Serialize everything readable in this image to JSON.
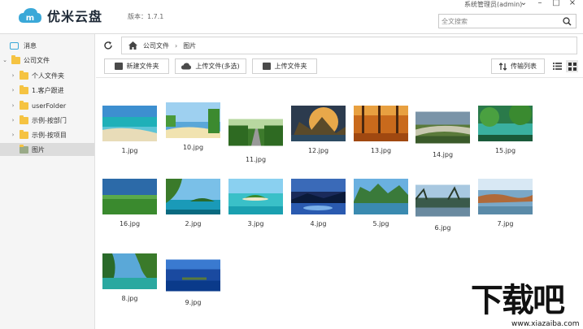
{
  "header": {
    "app_name": "优米云盘",
    "version": "版本：1.7.1",
    "user": "系统管理员(admin)",
    "search_placeholder": "全文搜索"
  },
  "sidebar": {
    "items": [
      {
        "label": "消息",
        "icon": "message-icon",
        "level": 0
      },
      {
        "label": "公司文件",
        "icon": "folder-icon",
        "level": 0,
        "expanded": true
      },
      {
        "label": "个人文件夹",
        "icon": "user-folder-icon",
        "level": 1
      },
      {
        "label": "1.客户跟进",
        "icon": "folder-icon",
        "level": 1
      },
      {
        "label": "userFolder",
        "icon": "folder-icon",
        "level": 1
      },
      {
        "label": "示例-按部门",
        "icon": "folder-icon",
        "level": 1
      },
      {
        "label": "示例-按项目",
        "icon": "folder-icon",
        "level": 1
      },
      {
        "label": "图片",
        "icon": "image-folder-icon",
        "level": 1,
        "selected": true
      }
    ]
  },
  "breadcrumb": [
    "公司文件",
    "图片"
  ],
  "toolbar": {
    "new_folder": "新建文件夹",
    "upload_files": "上传文件(多选)",
    "upload_folder": "上传文件夹",
    "transfer_list": "传输列表"
  },
  "files": [
    {
      "name": "1.jpg"
    },
    {
      "name": "10.jpg"
    },
    {
      "name": "11.jpg"
    },
    {
      "name": "12.jpg"
    },
    {
      "name": "13.jpg"
    },
    {
      "name": "14.jpg"
    },
    {
      "name": "15.jpg"
    },
    {
      "name": "16.jpg"
    },
    {
      "name": "2.jpg"
    },
    {
      "name": "3.jpg"
    },
    {
      "name": "4.jpg"
    },
    {
      "name": "5.jpg"
    },
    {
      "name": "6.jpg"
    },
    {
      "name": "7.jpg"
    },
    {
      "name": "8.jpg"
    },
    {
      "name": "9.jpg"
    }
  ],
  "watermark": {
    "title": "下载吧",
    "url": "www.xiazaiba.com"
  },
  "colors": {
    "accent": "#3aa8d8",
    "folder": "#f5c342",
    "selected_bg": "#dcdcdc"
  }
}
